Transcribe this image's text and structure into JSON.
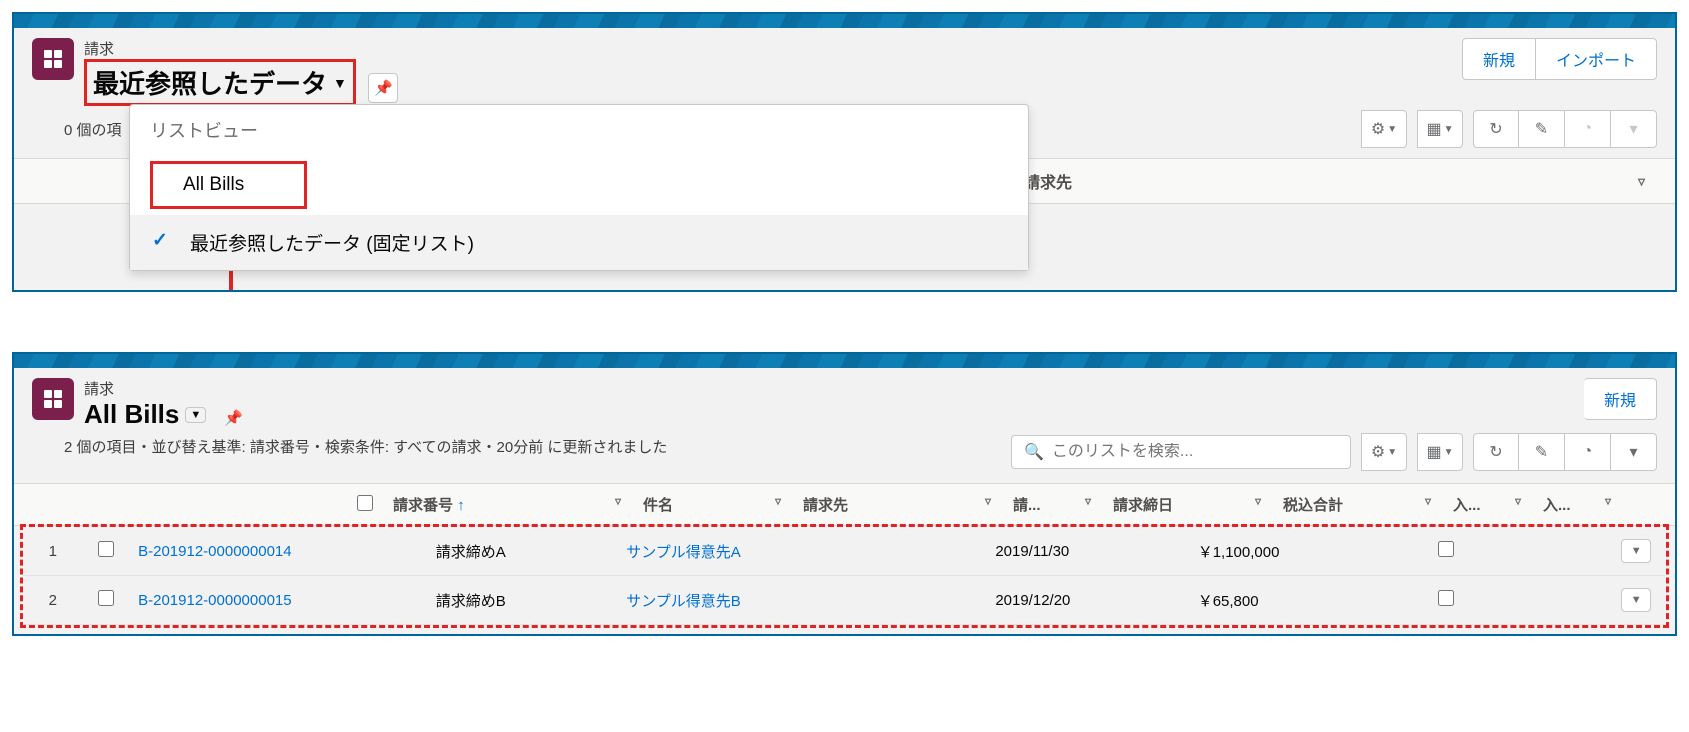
{
  "top": {
    "object_label": "請求",
    "view_title": "最近参照したデータ",
    "items_text": "0 個の項",
    "actions": {
      "new": "新規",
      "import": "インポート"
    },
    "dropdown": {
      "header": "リストビュー",
      "item_all": "All Bills",
      "item_recent": "最近参照したデータ (固定リスト)"
    },
    "col_header_visible": "請求先"
  },
  "bottom": {
    "object_label": "請求",
    "view_title": "All Bills",
    "meta": "2 個の項目・並び替え基準: 請求番号・検索条件: すべての請求・20分前 に更新されました",
    "search_placeholder": "このリストを検索...",
    "actions": {
      "new": "新規"
    },
    "columns": {
      "c1": "請求番号",
      "c2": "件名",
      "c3": "請求先",
      "c4": "請...",
      "c5": "請求締日",
      "c6": "税込合計",
      "c7": "入...",
      "c8": "入..."
    },
    "rows": [
      {
        "idx": "1",
        "bill_no": "B-201912-0000000014",
        "subject": "請求締めA",
        "account": "サンプル得意先A",
        "due": "2019/11/30",
        "total": "￥1,100,000"
      },
      {
        "idx": "2",
        "bill_no": "B-201912-0000000015",
        "subject": "請求締めB",
        "account": "サンプル得意先B",
        "due": "2019/12/20",
        "total": "￥65,800"
      }
    ]
  }
}
